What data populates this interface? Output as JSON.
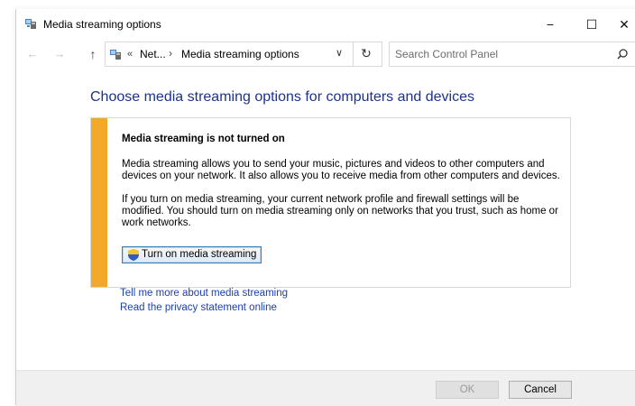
{
  "window": {
    "title": "Media streaming options",
    "minimize_glyph": "−",
    "maximize_glyph": "☐",
    "close_glyph": "✕"
  },
  "nav": {
    "back_glyph": "←",
    "forward_glyph": "→",
    "up_glyph": "↑"
  },
  "address": {
    "overflow": "«",
    "crumbs": [
      "Net...",
      "Media streaming options"
    ],
    "separator": "›",
    "dropdown_glyph": "∨",
    "refresh_glyph": "↻"
  },
  "search": {
    "placeholder": "Search Control Panel",
    "value": ""
  },
  "content": {
    "heading": "Choose media streaming options for computers and devices",
    "info_title": "Media streaming is not turned on",
    "para1": "Media streaming allows you to send your music, pictures and videos to other computers and devices on your network.  It also allows you to receive media from other computers and devices.",
    "para2": "If you turn on media streaming, your current network profile and firewall settings will be modified. You should turn on media streaming only on networks that you trust, such as home or work networks.",
    "turn_on_label": "Turn on media streaming",
    "links": [
      "Tell me more about media streaming",
      "Read the privacy statement online"
    ]
  },
  "footer": {
    "ok_label": "OK",
    "cancel_label": "Cancel"
  },
  "colors": {
    "heading": "#1e3287",
    "link": "#1a3fb0",
    "warning_stripe": "#f2a829"
  },
  "icons": [
    "media-streaming-icon",
    "minimize-icon",
    "maximize-icon",
    "close-icon",
    "back-arrow-icon",
    "forward-arrow-icon",
    "up-arrow-icon",
    "location-icon",
    "chevron-down-icon",
    "refresh-icon",
    "search-icon",
    "uac-shield-icon"
  ]
}
